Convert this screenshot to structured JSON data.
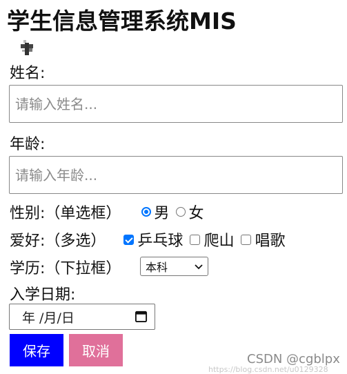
{
  "page_title": "学生信息管理系统MIS",
  "name_field": {
    "label": "姓名:",
    "placeholder": "请输入姓名..."
  },
  "age_field": {
    "label": "年龄:",
    "placeholder": "请输入年龄..."
  },
  "gender": {
    "label": "性别:（单选框）",
    "options": [
      {
        "label": "男",
        "checked": true
      },
      {
        "label": "女",
        "checked": false
      }
    ]
  },
  "hobby": {
    "label": "爱好:（多选）",
    "options": [
      {
        "label": "乒乓球",
        "checked": true
      },
      {
        "label": "爬山",
        "checked": false
      },
      {
        "label": "唱歌",
        "checked": false
      }
    ]
  },
  "education": {
    "label": "学历:（下拉框）",
    "selected": "本科"
  },
  "enroll_date": {
    "label": "入学日期:",
    "placeholder": "年 /月/日"
  },
  "buttons": {
    "save": "保存",
    "cancel": "取消"
  },
  "colors": {
    "save_bg": "#0000ff",
    "cancel_bg": "#e0709a",
    "accent": "#0075ff"
  },
  "watermark": {
    "brand": "CSDN @cgblpx",
    "url": "https://blog.csdn.net/u0129328"
  }
}
